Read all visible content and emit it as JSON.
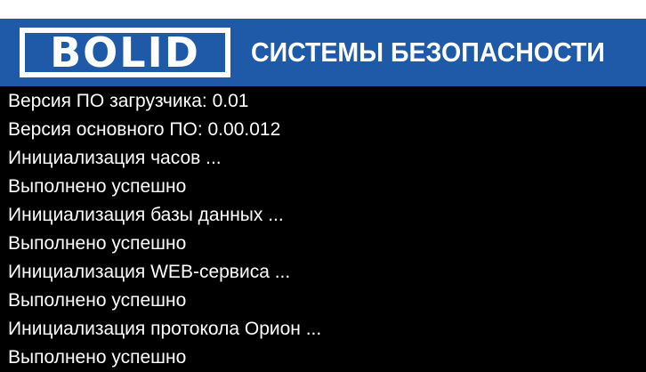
{
  "header": {
    "logo_text": "BOLID",
    "tagline": "СИСТЕМЫ БЕЗОПАСНОСТИ",
    "background_color": "#1e5aa7"
  },
  "console": {
    "background_color": "#000000",
    "text_color": "#ffffff",
    "lines": [
      "Версия ПО загрузчика: 0.01",
      "Версия основного ПО: 0.00.012",
      "Инициализация часов ...",
      "Выполнено успешно",
      "Инициализация базы данных ...",
      "Выполнено успешно",
      "Инициализация WEB-сервиса ...",
      "Выполнено успешно",
      "Инициализация протокола Орион ...",
      "Выполнено успешно"
    ]
  }
}
